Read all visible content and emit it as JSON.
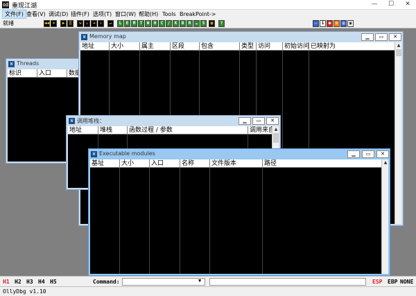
{
  "app": {
    "title": "重现江湖",
    "icon_name": "ollydbg-icon"
  },
  "menu": [
    "文件(F)",
    "查看(V)",
    "调试(D)",
    "插件(F)",
    "选项(T)",
    "窗口(W)",
    "帮助(H)",
    "Tools",
    "BreakPoint->"
  ],
  "toolbar": {
    "status": "就绪",
    "buttons": [
      {
        "label": "◀◀",
        "name": "restart-icon",
        "style": "dark"
      },
      {
        "label": "×",
        "name": "close-program-icon",
        "style": "dark"
      },
      {
        "label": "▶",
        "name": "run-icon",
        "style": "dark"
      },
      {
        "label": "‖",
        "name": "pause-icon",
        "style": "dark"
      },
      {
        "label": "⇲",
        "name": "step-into-icon",
        "style": "dark"
      },
      {
        "label": "⇣",
        "name": "step-over-icon",
        "style": "dark"
      },
      {
        "label": "⇥",
        "name": "trace-into-icon",
        "style": "dark"
      },
      {
        "label": "⇩",
        "name": "trace-over-icon",
        "style": "dark"
      },
      {
        "label": "↵",
        "name": "execute-till-return-icon",
        "style": "dark"
      },
      {
        "label": "L",
        "name": "log-window-icon",
        "style": "green"
      },
      {
        "label": "E",
        "name": "modules-window-icon",
        "style": "green"
      },
      {
        "label": "M",
        "name": "memory-window-icon",
        "style": "green"
      },
      {
        "label": "T",
        "name": "threads-window-icon",
        "style": "green"
      },
      {
        "label": "W",
        "name": "windows-window-icon",
        "style": "green"
      },
      {
        "label": "H",
        "name": "handles-window-icon",
        "style": "green"
      },
      {
        "label": "C",
        "name": "cpu-window-icon",
        "style": "green"
      },
      {
        "label": "/",
        "name": "patches-window-icon",
        "style": "green"
      },
      {
        "label": "K",
        "name": "call-stack-window-icon",
        "style": "green"
      },
      {
        "label": "B",
        "name": "breakpoints-window-icon",
        "style": "green"
      },
      {
        "label": "R",
        "name": "references-window-icon",
        "style": "green"
      },
      {
        "label": "…",
        "name": "run-trace-window-icon",
        "style": "green"
      },
      {
        "label": "S",
        "name": "source-window-icon",
        "style": "green"
      },
      {
        "label": "▦",
        "name": "grid-icon",
        "style": "dark"
      },
      {
        "label": "?",
        "name": "help-icon",
        "style": "green"
      },
      {
        "label": "▭",
        "name": "window-tile-icon",
        "style": "blue"
      },
      {
        "label": "i",
        "name": "info-icon",
        "style": "white"
      },
      {
        "label": "●",
        "name": "record-icon",
        "style": "red"
      },
      {
        "label": "⚙",
        "name": "settings-icon",
        "style": "orange"
      },
      {
        "label": "▤",
        "name": "appearance-icon",
        "style": "blue"
      },
      {
        "label": "▣",
        "name": "options-icon",
        "style": "white"
      }
    ]
  },
  "windows": {
    "memory": {
      "title": "Memory map",
      "columns": [
        "地址",
        "大小",
        "属主",
        "区段",
        "包含",
        "类型",
        "访问",
        "初始访问",
        "已映射为"
      ]
    },
    "threads": {
      "title": "Threads",
      "columns": [
        "标识",
        "入口",
        "数据"
      ]
    },
    "callstack": {
      "title": "调用堆栈：",
      "columns": [
        "地址",
        "堆栈",
        "函数过程 / 参数",
        "调用来自"
      ]
    },
    "modules": {
      "title": "Executable modules",
      "columns": [
        "基址",
        "大小",
        "入口",
        "名称",
        "文件版本",
        "路径"
      ]
    }
  },
  "commandbar": {
    "history_buttons": [
      "H1",
      "H2",
      "H3",
      "H4",
      "H5"
    ],
    "label": "Command:",
    "value": "",
    "registers": [
      "ESP",
      "EBP",
      "NONE"
    ]
  },
  "statusbar": {
    "version": "OllyDbg v1.10"
  },
  "colors": {
    "active_register": "#e02020",
    "history_active": "#e02020",
    "mdi_background": "#808080"
  }
}
